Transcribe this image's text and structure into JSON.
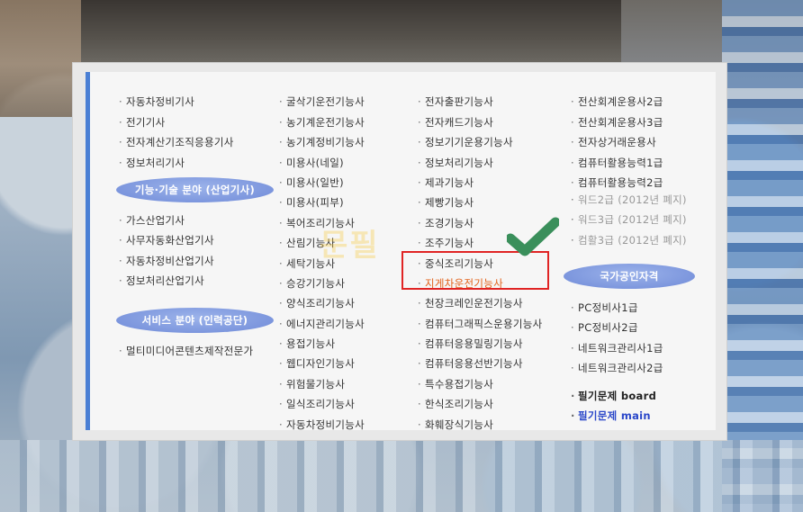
{
  "columns": {
    "col1": {
      "items_top": [
        "자동차정비기사",
        "전기기사",
        "전자계산기조직응용기사",
        "정보처리기사"
      ],
      "heading2": "기능·기술 분야 (산업기사)",
      "items_mid": [
        "가스산업기사",
        "사무자동화산업기사",
        "자동차정비산업기사",
        "정보처리산업기사"
      ],
      "heading3": "서비스 분야 (인력공단)",
      "items_bottom": [
        "멀티미디어콘텐츠제작전문가"
      ]
    },
    "col2": {
      "items": [
        "굴삭기운전기능사",
        "농기계운전기능사",
        "농기계정비기능사",
        "미용사(네일)",
        "미용사(일반)",
        "미용사(피부)",
        "복어조리기능사",
        "산림기능사",
        "세탁기능사",
        "승강기기능사",
        "양식조리기능사",
        "에너지관리기능사",
        "용접기능사",
        "웹디자인기능사",
        "위험물기능사",
        "일식조리기능사",
        "자동차정비기능사"
      ]
    },
    "col3": {
      "items": [
        "전자출판기능사",
        "전자캐드기능사",
        "정보기기운용기능사",
        "정보처리기능사",
        "제과기능사",
        "제빵기능사",
        "조경기능사",
        "조주기능사",
        "중식조리기능사",
        "지게차운전기능사",
        "천장크레인운전기능사",
        "컴퓨터그래픽스운용기능사",
        "컴퓨터응용밀링기능사",
        "컴퓨터응용선반기능사",
        "특수용접기능사",
        "한식조리기능사",
        "화훼장식기능사"
      ]
    },
    "col4": {
      "items_top": [
        "전산회계운용사2급",
        "전산회계운용사3급",
        "전자상거래운용사",
        "컴퓨터활용능력1급",
        "컴퓨터활용능력2급"
      ],
      "items_discontinued": [
        "워드2급 (2012년 폐지)",
        "워드3급 (2012년 폐지)",
        "컴활3급 (2012년 폐지)"
      ],
      "heading": "국가공인자격",
      "items_mid": [
        "PC정비사1급",
        "PC정비사2급",
        "네트워크관리사1급",
        "네트워크관리사2급"
      ],
      "link_board": "필기문제 board",
      "link_main": "필기문제 main"
    }
  },
  "watermark_text": "문필",
  "colors": {
    "accent": "#4a7fd4",
    "highlight": "#e02424",
    "check": "#3a8f5b",
    "selected": "#e2621b",
    "link": "#2a47c9"
  }
}
